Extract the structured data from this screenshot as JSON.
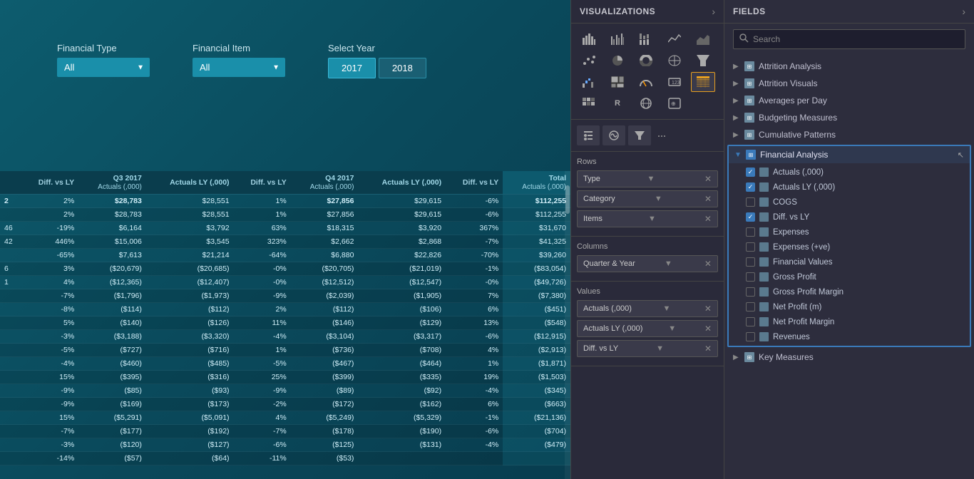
{
  "main": {
    "filters": {
      "financial_type_label": "Financial Type",
      "financial_type_value": "All",
      "financial_item_label": "Financial Item",
      "financial_item_value": "All",
      "select_year_label": "Select Year",
      "year1": "2017",
      "year2": "2018"
    },
    "table": {
      "col_headers": [
        "Q3 2017",
        "Actuals (,000)",
        "Actuals LY (,000)",
        "Diff. vs LY",
        "Q4 2017",
        "Actuals (,000)",
        "Actuals LY (,000)",
        "Diff. vs LY",
        "Total",
        "Actuals (,000)"
      ],
      "rows": [
        {
          "c0": "2",
          "c1": "2%",
          "c2": "$28,783",
          "c3": "$28,551",
          "c4": "1%",
          "c5": "$27,856",
          "c6": "$29,615",
          "c7": "-6%",
          "c8": "$112,255"
        },
        {
          "c0": "",
          "c1": "2%",
          "c2": "$28,783",
          "c3": "$28,551",
          "c4": "1%",
          "c5": "$27,856",
          "c6": "$29,615",
          "c7": "-6%",
          "c8": "$112,255"
        },
        {
          "c0": "46",
          "c1": "-19%",
          "c2": "$6,164",
          "c3": "$3,792",
          "c4": "63%",
          "c5": "$18,315",
          "c6": "$3,920",
          "c7": "367%",
          "c8": "$31,670"
        },
        {
          "c0": "42",
          "c1": "446%",
          "c2": "$15,006",
          "c3": "$3,545",
          "c4": "323%",
          "c5": "$2,662",
          "c6": "$2,868",
          "c7": "-7%",
          "c8": "$41,325"
        },
        {
          "c0": "",
          "c1": "-65%",
          "c2": "$7,613",
          "c3": "$21,214",
          "c4": "-64%",
          "c5": "$6,880",
          "c6": "$22,826",
          "c7": "-70%",
          "c8": "$39,260"
        },
        {
          "c0": "6",
          "c1": "3%",
          "c2": "($20,679)",
          "c3": "($20,685)",
          "c4": "-0%",
          "c5": "($20,705)",
          "c6": "($21,019)",
          "c7": "-1%",
          "c8": "($83,054)"
        },
        {
          "c0": "1",
          "c1": "4%",
          "c2": "($12,365)",
          "c3": "($12,407)",
          "c4": "-0%",
          "c5": "($12,512)",
          "c6": "($12,547)",
          "c7": "-0%",
          "c8": "($49,726)"
        },
        {
          "c0": "",
          "c1": "-7%",
          "c2": "($1,796)",
          "c3": "($1,973)",
          "c4": "-9%",
          "c5": "($2,039)",
          "c6": "($1,905)",
          "c7": "7%",
          "c8": "($7,380)"
        },
        {
          "c0": "",
          "c1": "-8%",
          "c2": "($114)",
          "c3": "($112)",
          "c4": "2%",
          "c5": "($112)",
          "c6": "($106)",
          "c7": "6%",
          "c8": "($451)"
        },
        {
          "c0": "",
          "c1": "5%",
          "c2": "($140)",
          "c3": "($126)",
          "c4": "11%",
          "c5": "($146)",
          "c6": "($129)",
          "c7": "13%",
          "c8": "($548)"
        },
        {
          "c0": "",
          "c1": "-3%",
          "c2": "($3,188)",
          "c3": "($3,320)",
          "c4": "-4%",
          "c5": "($3,104)",
          "c6": "($3,317)",
          "c7": "-6%",
          "c8": "($12,915)"
        },
        {
          "c0": "",
          "c1": "-5%",
          "c2": "($727)",
          "c3": "($716)",
          "c4": "1%",
          "c5": "($736)",
          "c6": "($708)",
          "c7": "4%",
          "c8": "($2,913)"
        },
        {
          "c0": "",
          "c1": "-4%",
          "c2": "($460)",
          "c3": "($485)",
          "c4": "-5%",
          "c5": "($467)",
          "c6": "($464)",
          "c7": "1%",
          "c8": "($1,871)"
        },
        {
          "c0": "",
          "c1": "15%",
          "c2": "($395)",
          "c3": "($316)",
          "c4": "25%",
          "c5": "($399)",
          "c6": "($335)",
          "c7": "19%",
          "c8": "($1,503)"
        },
        {
          "c0": "",
          "c1": "-9%",
          "c2": "($85)",
          "c3": "($93)",
          "c4": "-9%",
          "c5": "($89)",
          "c6": "($92)",
          "c7": "-4%",
          "c8": "($345)"
        },
        {
          "c0": "",
          "c1": "-9%",
          "c2": "($169)",
          "c3": "($173)",
          "c4": "-2%",
          "c5": "($172)",
          "c6": "($162)",
          "c7": "6%",
          "c8": "($663)"
        },
        {
          "c0": "",
          "c1": "15%",
          "c2": "($5,291)",
          "c3": "($5,091)",
          "c4": "4%",
          "c5": "($5,249)",
          "c6": "($5,329)",
          "c7": "-1%",
          "c8": "($21,136)"
        },
        {
          "c0": "",
          "c1": "-7%",
          "c2": "($177)",
          "c3": "($192)",
          "c4": "-7%",
          "c5": "($178)",
          "c6": "($190)",
          "c7": "-6%",
          "c8": "($704)"
        },
        {
          "c0": "",
          "c1": "-3%",
          "c2": "($120)",
          "c3": "($127)",
          "c4": "-6%",
          "c5": "($125)",
          "c6": "($131)",
          "c7": "-4%",
          "c8": "($479)"
        },
        {
          "c0": "",
          "c1": "-14%",
          "c2": "($57)",
          "c3": "($64)",
          "c4": "-11%",
          "c5": "($53)",
          "c6": "",
          "c7": "",
          "c8": ""
        }
      ]
    }
  },
  "visualizations": {
    "title": "VISUALIZATIONS",
    "expand_icon": "›",
    "sections": {
      "rows_label": "Rows",
      "type_chip": "Type",
      "category_chip": "Category",
      "items_chip": "Items",
      "columns_label": "Columns",
      "quarter_year_chip": "Quarter & Year",
      "values_label": "Values",
      "actuals_chip": "Actuals (,000)",
      "actuals_ly_chip": "Actuals LY (,000)",
      "diff_chip": "Diff. vs LY"
    }
  },
  "fields": {
    "title": "FIELDS",
    "expand_icon": "›",
    "search_placeholder": "Search",
    "items": [
      {
        "label": "Attrition Analysis",
        "expanded": false,
        "checked": false
      },
      {
        "label": "Attrition Visuals",
        "expanded": false,
        "checked": false
      },
      {
        "label": "Averages per Day",
        "expanded": false,
        "checked": false
      },
      {
        "label": "Budgeting Measures",
        "expanded": false,
        "checked": false
      },
      {
        "label": "Cumulative Patterns",
        "expanded": false,
        "checked": false
      },
      {
        "label": "Financial Analysis",
        "expanded": true,
        "checked": false
      }
    ],
    "financial_analysis": {
      "label": "Financial Analysis",
      "fields": [
        {
          "label": "Actuals (,000)",
          "checked": true
        },
        {
          "label": "Actuals LY (,000)",
          "checked": true
        },
        {
          "label": "COGS",
          "checked": false
        },
        {
          "label": "Diff. vs LY",
          "checked": true
        },
        {
          "label": "Expenses",
          "checked": false
        },
        {
          "label": "Expenses (+ve)",
          "checked": false
        },
        {
          "label": "Financial Values",
          "checked": false
        },
        {
          "label": "Gross Profit",
          "checked": false
        },
        {
          "label": "Gross Profit Margin",
          "checked": false
        },
        {
          "label": "Net Profit (m)",
          "checked": false
        },
        {
          "label": "Net Profit Margin",
          "checked": false
        },
        {
          "label": "Revenues",
          "checked": false
        }
      ]
    },
    "bottom_items": [
      {
        "label": "Key Measures"
      }
    ]
  }
}
